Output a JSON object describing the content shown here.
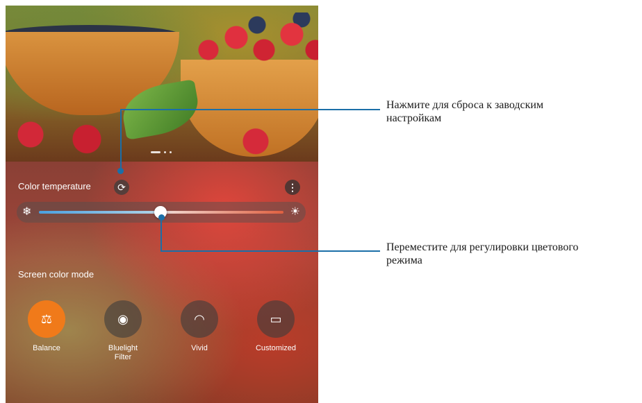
{
  "panel": {
    "color_temperature_label": "Color temperature",
    "screen_color_mode_label": "Screen color mode",
    "slider_level_percent": 50
  },
  "modes": [
    {
      "label": "Balance",
      "icon": "balance-icon",
      "active": true
    },
    {
      "label": "Bluelight\nFilter",
      "icon": "eye-shield-icon",
      "active": false
    },
    {
      "label": "Vivid",
      "icon": "rainbow-icon",
      "active": false
    },
    {
      "label": "Customized",
      "icon": "screen-settings-icon",
      "active": false
    }
  ],
  "callouts": {
    "reset": "Нажмите для сброса к заводским\nнастройкам",
    "slider": "Переместите для регулировки цветового\nрежима"
  },
  "colors": {
    "accent": "#f07a1a",
    "callout_line": "#1a6fa8"
  }
}
